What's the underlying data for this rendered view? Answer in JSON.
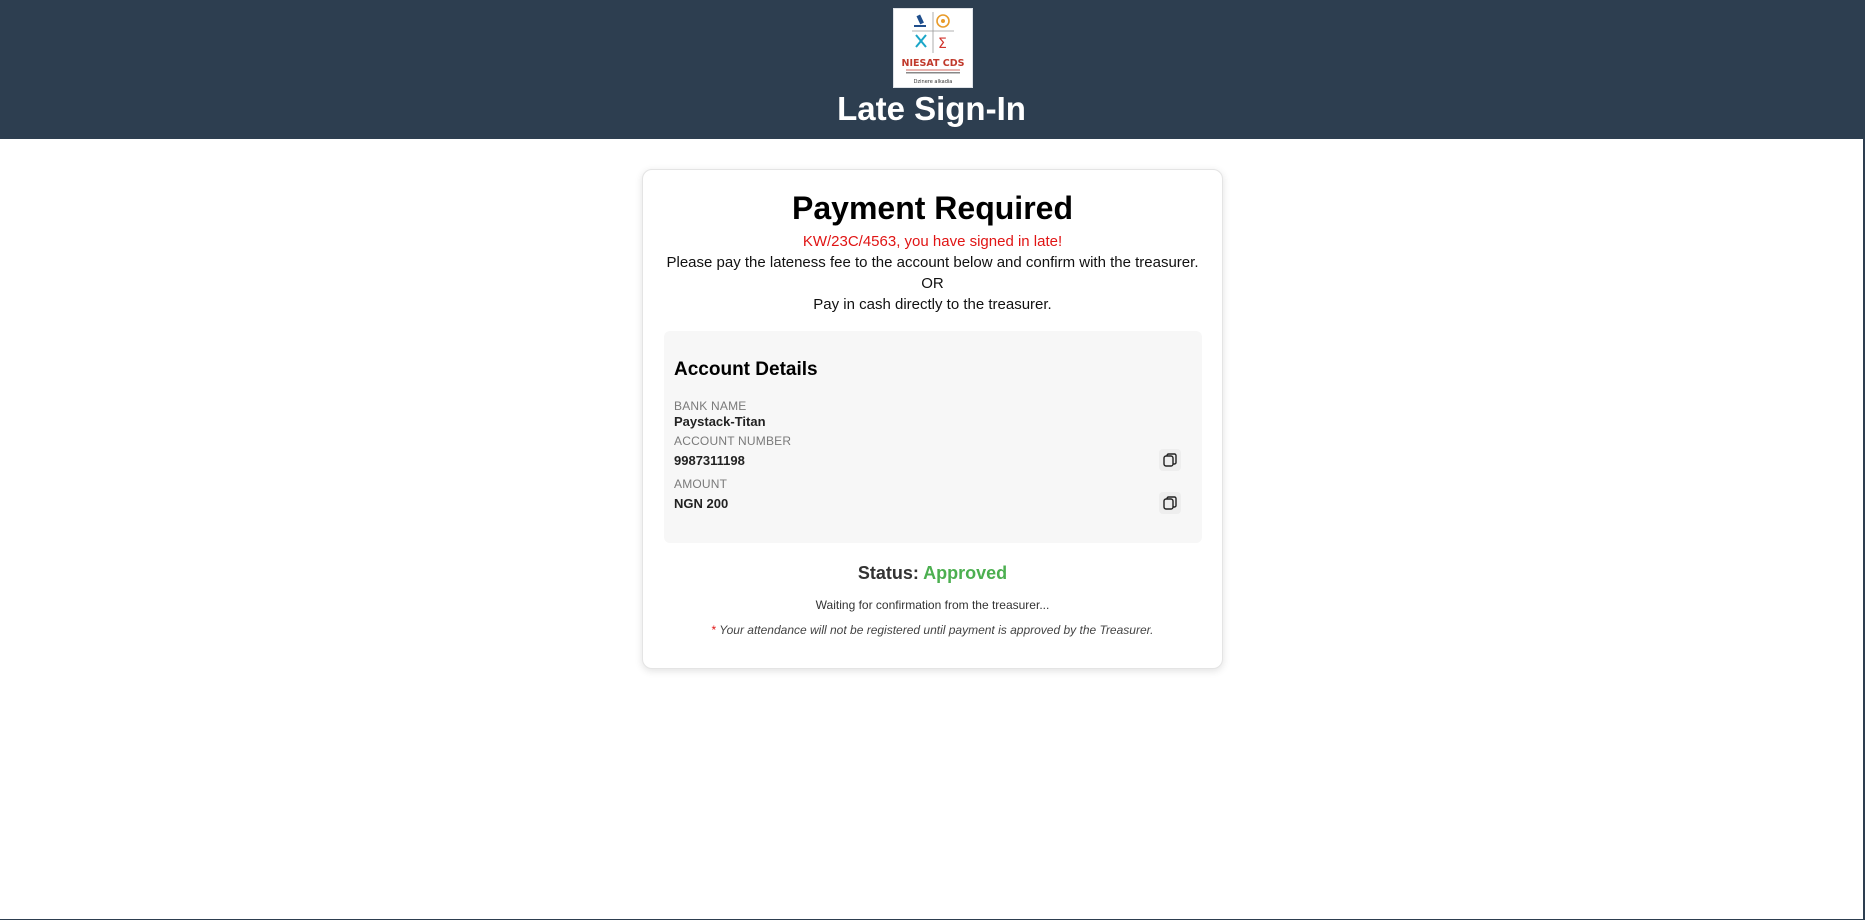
{
  "header": {
    "logo_text": "NIESAT CDS",
    "logo_subtext": "Dzinere alkadia",
    "title": "Late Sign-In"
  },
  "card": {
    "title": "Payment Required",
    "late_message": "KW/23C/4563, you have signed in late!",
    "instruction_1": "Please pay the lateness fee to the account below and confirm with the treasurer.",
    "or_text": "OR",
    "instruction_2": "Pay in cash directly to the treasurer.",
    "account_details": {
      "title": "Account Details",
      "bank_name_label": "BANK NAME",
      "bank_name_value": "Paystack-Titan",
      "account_number_label": "ACCOUNT NUMBER",
      "account_number_value": "9987311198",
      "amount_label": "AMOUNT",
      "amount_value": "NGN 200"
    },
    "status_label": "Status:",
    "status_value": "Approved",
    "waiting_text": "Waiting for confirmation from the treasurer...",
    "note_asterisk": "*",
    "note_text": "Your attendance will not be registered until payment is approved by the Treasurer."
  },
  "colors": {
    "header_bg": "#2d3e50",
    "late_red": "#e01414",
    "approved_green": "#4caf50"
  },
  "icons": {
    "copy": "copy-icon"
  }
}
